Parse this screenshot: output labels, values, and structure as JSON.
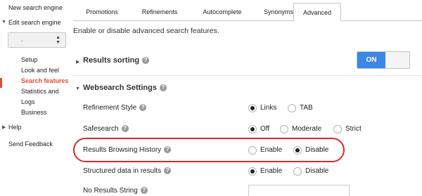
{
  "sidebar": {
    "new_engine": "New search engine",
    "edit_engine": "Edit search engine",
    "select_value": "-",
    "items": [
      "Setup",
      "Look and feel",
      "Search features",
      "Statistics and",
      "Logs",
      "Business"
    ],
    "help": "Help",
    "feedback": "Send Feedback"
  },
  "tabs": [
    "Promotions",
    "Refinements",
    "Autocomplete",
    "Synonyms",
    "Advanced"
  ],
  "active_tab": "Advanced",
  "description": "Enable or disable advanced search features.",
  "results_sorting": {
    "title": "Results sorting",
    "toggle": "ON"
  },
  "websearch": {
    "title": "Websearch Settings"
  },
  "rows": {
    "refinement_style": {
      "label": "Refinement Style",
      "options": [
        "Links",
        "TAB"
      ],
      "selected": "Links"
    },
    "safesearch": {
      "label": "Safesearch",
      "options": [
        "Off",
        "Moderate",
        "Strict"
      ],
      "selected": "Off"
    },
    "browsing_history": {
      "label": "Results Browsing History",
      "options": [
        "Enable",
        "Disable"
      ],
      "selected": "Disable"
    },
    "structured_data": {
      "label": "Structured data in results",
      "options": [
        "Enable",
        "Disable"
      ],
      "selected": "Enable"
    },
    "no_results": {
      "label": "No Results String",
      "value": ""
    }
  },
  "colors": {
    "accent": "#3b87e8",
    "active_red": "#dd4b39",
    "highlight_red": "#d42a2a"
  }
}
